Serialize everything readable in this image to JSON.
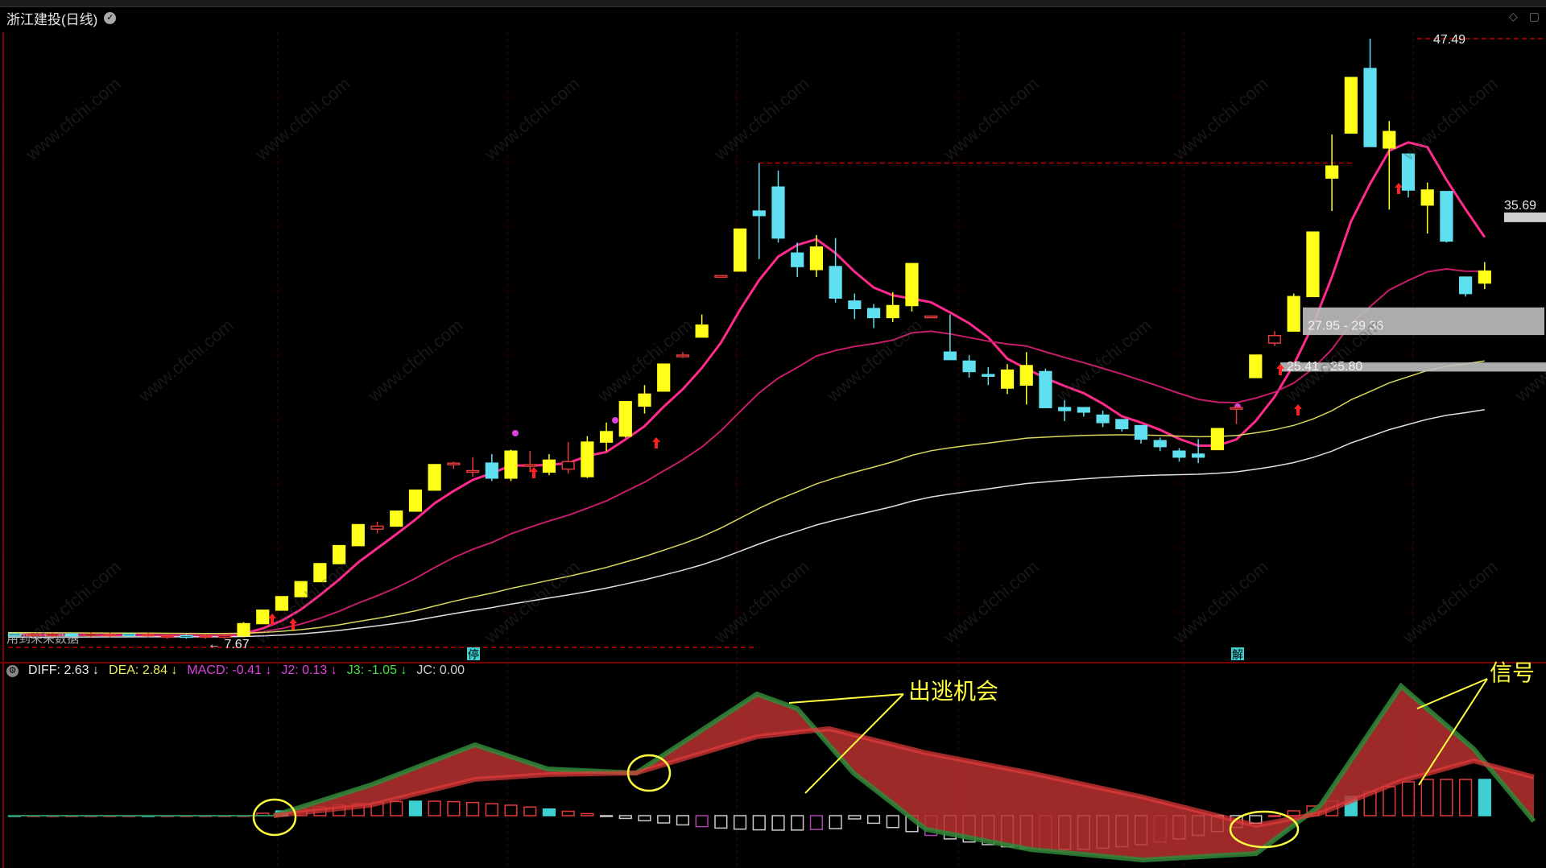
{
  "window": {
    "title": "浙江建投(日线)"
  },
  "main_chart": {
    "price_labels": {
      "high": "47.49",
      "last": "35.69",
      "low": "7.67"
    },
    "zones": [
      {
        "label": "27.95 - 29.36"
      },
      {
        "label": "25.41 - 25.80"
      }
    ],
    "bottom_note": "用到未来数据",
    "markers": {
      "ting": "停",
      "jie": "解"
    }
  },
  "indicator": {
    "items": [
      {
        "name": "DIFF: 2.63",
        "arrow": "↓",
        "color": "#e8e8e8"
      },
      {
        "name": "DEA: 2.84",
        "arrow": "↓",
        "color": "#e8e860"
      },
      {
        "name": "MACD: -0.41",
        "arrow": "↓",
        "color": "#e040e0"
      },
      {
        "name": "J2: 0.13",
        "arrow": "↓",
        "color": "#e040e0"
      },
      {
        "name": "J3: -1.05",
        "arrow": "↓",
        "color": "#40e040"
      },
      {
        "name": "JC: 0.00",
        "arrow": "",
        "color": "#cccccc"
      }
    ],
    "annotations": {
      "escape": "出逃机会",
      "signal": "信号"
    }
  },
  "chart_data": {
    "type": "candlestick",
    "title": "浙江建投(日线)",
    "candles": [
      {
        "o": 7.7,
        "c": 7.8,
        "h": 7.9,
        "l": 7.5
      },
      {
        "o": 7.8,
        "c": 7.7,
        "h": 7.9,
        "l": 7.6
      },
      {
        "o": 7.7,
        "c": 7.8,
        "h": 7.9,
        "l": 7.6
      },
      {
        "o": 7.8,
        "c": 7.7,
        "h": 7.9,
        "l": 7.6
      },
      {
        "o": 7.7,
        "c": 7.8,
        "h": 7.9,
        "l": 7.6
      },
      {
        "o": 7.8,
        "c": 7.7,
        "h": 7.9,
        "l": 7.6
      },
      {
        "o": 7.7,
        "c": 7.8,
        "h": 7.9,
        "l": 7.6
      },
      {
        "o": 7.8,
        "c": 7.7,
        "h": 7.9,
        "l": 7.6
      },
      {
        "o": 7.7,
        "c": 7.6,
        "h": 7.8,
        "l": 7.5
      },
      {
        "o": 7.6,
        "c": 7.7,
        "h": 7.8,
        "l": 7.5
      },
      {
        "o": 7.7,
        "c": 7.6,
        "h": 7.8,
        "l": 7.5
      },
      {
        "o": 7.6,
        "c": 7.7,
        "h": 7.8,
        "l": 7.5
      },
      {
        "o": 7.7,
        "c": 8.5,
        "h": 8.6,
        "l": 7.6
      },
      {
        "o": 8.5,
        "c": 9.4,
        "h": 9.4,
        "l": 8.5
      },
      {
        "o": 9.4,
        "c": 10.3,
        "h": 10.3,
        "l": 9.4
      },
      {
        "o": 10.3,
        "c": 11.3,
        "h": 11.3,
        "l": 10.3
      },
      {
        "o": 11.3,
        "c": 12.5,
        "h": 12.5,
        "l": 11.3
      },
      {
        "o": 12.5,
        "c": 13.7,
        "h": 13.7,
        "l": 12.5
      },
      {
        "o": 13.7,
        "c": 15.1,
        "h": 15.1,
        "l": 13.7
      },
      {
        "o": 14.8,
        "c": 15.0,
        "h": 15.3,
        "l": 14.5
      },
      {
        "o": 15.0,
        "c": 16.0,
        "h": 16.0,
        "l": 15.0
      },
      {
        "o": 16.0,
        "c": 17.4,
        "h": 17.4,
        "l": 16.0
      },
      {
        "o": 17.4,
        "c": 19.1,
        "h": 19.1,
        "l": 17.4
      },
      {
        "o": 19.1,
        "c": 19.2,
        "h": 19.3,
        "l": 18.8
      },
      {
        "o": 18.6,
        "c": 18.7,
        "h": 19.6,
        "l": 18.3
      },
      {
        "o": 19.2,
        "c": 18.2,
        "h": 19.8,
        "l": 18.0
      },
      {
        "o": 18.2,
        "c": 20.0,
        "h": 20.1,
        "l": 18.0
      },
      {
        "o": 19.0,
        "c": 19.1,
        "h": 20.0,
        "l": 18.6
      },
      {
        "o": 18.6,
        "c": 19.4,
        "h": 19.8,
        "l": 18.4
      },
      {
        "o": 18.8,
        "c": 19.3,
        "h": 20.6,
        "l": 18.5
      },
      {
        "o": 18.3,
        "c": 20.6,
        "h": 21.0,
        "l": 18.2
      },
      {
        "o": 20.6,
        "c": 21.3,
        "h": 21.9,
        "l": 20.0
      },
      {
        "o": 21.0,
        "c": 23.3,
        "h": 23.3,
        "l": 20.9
      },
      {
        "o": 23.0,
        "c": 23.8,
        "h": 24.4,
        "l": 22.5
      },
      {
        "o": 24.0,
        "c": 25.8,
        "h": 25.8,
        "l": 24.0
      },
      {
        "o": 26.3,
        "c": 26.4,
        "h": 26.6,
        "l": 26.2
      },
      {
        "o": 27.6,
        "c": 28.4,
        "h": 29.1,
        "l": 27.6
      },
      {
        "o": 31.6,
        "c": 31.7,
        "h": 31.7,
        "l": 31.6
      },
      {
        "o": 32.0,
        "c": 34.8,
        "h": 34.8,
        "l": 32.0
      },
      {
        "o": 36.0,
        "c": 35.7,
        "h": 39.2,
        "l": 32.8
      },
      {
        "o": 37.6,
        "c": 34.2,
        "h": 38.7,
        "l": 33.9
      },
      {
        "o": 33.2,
        "c": 32.3,
        "h": 33.9,
        "l": 31.6
      },
      {
        "o": 32.1,
        "c": 33.6,
        "h": 34.4,
        "l": 31.6
      },
      {
        "o": 32.3,
        "c": 30.2,
        "h": 34.2,
        "l": 29.9
      },
      {
        "o": 30.0,
        "c": 29.5,
        "h": 30.5,
        "l": 28.8
      },
      {
        "o": 29.5,
        "c": 28.9,
        "h": 29.8,
        "l": 28.2
      },
      {
        "o": 28.9,
        "c": 29.7,
        "h": 30.6,
        "l": 28.6
      },
      {
        "o": 29.7,
        "c": 32.5,
        "h": 32.5,
        "l": 29.3
      },
      {
        "o": 29.0,
        "c": 29.0,
        "h": 29.0,
        "l": 29.0
      },
      {
        "o": 26.6,
        "c": 26.1,
        "h": 29.1,
        "l": 26.1
      },
      {
        "o": 26.0,
        "c": 25.3,
        "h": 26.4,
        "l": 24.9
      },
      {
        "o": 25.1,
        "c": 25.0,
        "h": 25.6,
        "l": 24.4
      },
      {
        "o": 24.2,
        "c": 25.4,
        "h": 25.8,
        "l": 23.8
      },
      {
        "o": 24.4,
        "c": 25.7,
        "h": 26.6,
        "l": 23.1
      },
      {
        "o": 25.3,
        "c": 22.9,
        "h": 25.5,
        "l": 22.9
      },
      {
        "o": 22.9,
        "c": 22.7,
        "h": 23.4,
        "l": 22.0
      },
      {
        "o": 22.9,
        "c": 22.6,
        "h": 22.9,
        "l": 22.3
      },
      {
        "o": 22.4,
        "c": 21.9,
        "h": 22.7,
        "l": 21.6
      },
      {
        "o": 22.1,
        "c": 21.5,
        "h": 22.1,
        "l": 21.3
      },
      {
        "o": 21.7,
        "c": 20.8,
        "h": 21.7,
        "l": 20.5
      },
      {
        "o": 20.7,
        "c": 20.3,
        "h": 20.9,
        "l": 20.0
      },
      {
        "o": 20.0,
        "c": 19.6,
        "h": 20.2,
        "l": 19.3
      },
      {
        "o": 19.8,
        "c": 19.6,
        "h": 20.8,
        "l": 19.2
      },
      {
        "o": 20.1,
        "c": 21.5,
        "h": 21.5,
        "l": 20.1
      },
      {
        "o": 22.8,
        "c": 22.9,
        "h": 23.0,
        "l": 21.8
      },
      {
        "o": 24.9,
        "c": 26.4,
        "h": 26.4,
        "l": 24.9
      },
      {
        "o": 27.2,
        "c": 27.7,
        "h": 28.0,
        "l": 27.0
      },
      {
        "o": 28.0,
        "c": 30.3,
        "h": 30.5,
        "l": 28.0
      },
      {
        "o": 30.3,
        "c": 34.6,
        "h": 34.6,
        "l": 30.3
      },
      {
        "o": 38.2,
        "c": 39.0,
        "h": 41.1,
        "l": 36.0
      },
      {
        "o": 41.2,
        "c": 44.9,
        "h": 44.9,
        "l": 41.2
      },
      {
        "o": 45.5,
        "c": 40.3,
        "h": 47.49,
        "l": 40.3
      },
      {
        "o": 40.2,
        "c": 41.3,
        "h": 42.0,
        "l": 36.1
      },
      {
        "o": 39.8,
        "c": 37.4,
        "h": 39.8,
        "l": 36.9
      },
      {
        "o": 36.4,
        "c": 37.4,
        "h": 37.9,
        "l": 34.5
      },
      {
        "o": 37.3,
        "c": 34.0,
        "h": 37.3,
        "l": 33.9
      },
      {
        "o": 31.6,
        "c": 30.5,
        "h": 31.6,
        "l": 30.3
      },
      {
        "o": 31.2,
        "c": 32.0,
        "h": 32.6,
        "l": 30.8
      }
    ],
    "ma_lines": [
      {
        "name": "MA-short",
        "color": "#ff2a8c"
      },
      {
        "name": "MA-mid",
        "color": "#c41d6a"
      },
      {
        "name": "MA-long",
        "color": "#d8d85a"
      },
      {
        "name": "MA-longest",
        "color": "#e0e0e0"
      }
    ],
    "indicator_values": {
      "DIFF": 2.63,
      "DEA": 2.84,
      "MACD": -0.41,
      "J2": 0.13,
      "J3": -1.05,
      "JC": 0.0
    }
  }
}
